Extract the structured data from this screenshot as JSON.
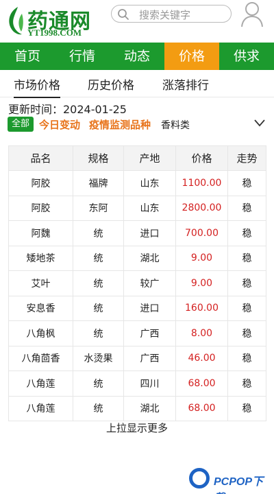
{
  "header": {
    "logo_name": "药通网",
    "logo_url": "YT1998.COM",
    "search_placeholder": "搜索关键字"
  },
  "nav": {
    "items": [
      {
        "label": "首页",
        "active": false
      },
      {
        "label": "行情",
        "active": false
      },
      {
        "label": "动态",
        "active": false
      },
      {
        "label": "价格",
        "active": true
      },
      {
        "label": "供求",
        "active": false
      }
    ]
  },
  "subtabs": [
    {
      "label": "市场价格",
      "active": true
    },
    {
      "label": "历史价格",
      "active": false
    },
    {
      "label": "涨落排行",
      "active": false
    }
  ],
  "update": {
    "text": "更新时间：2024-01-25"
  },
  "filters": {
    "all": "全部",
    "today": "今日变动",
    "monitor": "疫情监测品种",
    "category": "香料类"
  },
  "table": {
    "headers": [
      "品名",
      "规格",
      "产地",
      "价格",
      "走势"
    ],
    "rows": [
      [
        "阿胶",
        "福牌",
        "山东",
        "1100.00",
        "稳"
      ],
      [
        "阿胶",
        "东阿",
        "山东",
        "2800.00",
        "稳"
      ],
      [
        "阿魏",
        "统",
        "进口",
        "700.00",
        "稳"
      ],
      [
        "矮地茶",
        "统",
        "湖北",
        "9.00",
        "稳"
      ],
      [
        "艾叶",
        "统",
        "较广",
        "9.00",
        "稳"
      ],
      [
        "安息香",
        "统",
        "进口",
        "160.00",
        "稳"
      ],
      [
        "八角枫",
        "统",
        "广西",
        "8.00",
        "稳"
      ],
      [
        "八角茴香",
        "水烫果",
        "广西",
        "46.00",
        "稳"
      ],
      [
        "八角莲",
        "统",
        "四川",
        "68.00",
        "稳"
      ],
      [
        "八角莲",
        "统",
        "湖北",
        "68.00",
        "稳"
      ]
    ]
  },
  "more": "上拉显示更多",
  "watermark": "PCPOP下载",
  "colors": {
    "brand_green": "#1c9a2e",
    "active_orange": "#f39c12",
    "filter_orange": "#e8731a",
    "price_red": "#d42020"
  },
  "icons": {
    "search": "search-icon",
    "user": "user-icon",
    "dropdown": "chevron-down-icon"
  }
}
